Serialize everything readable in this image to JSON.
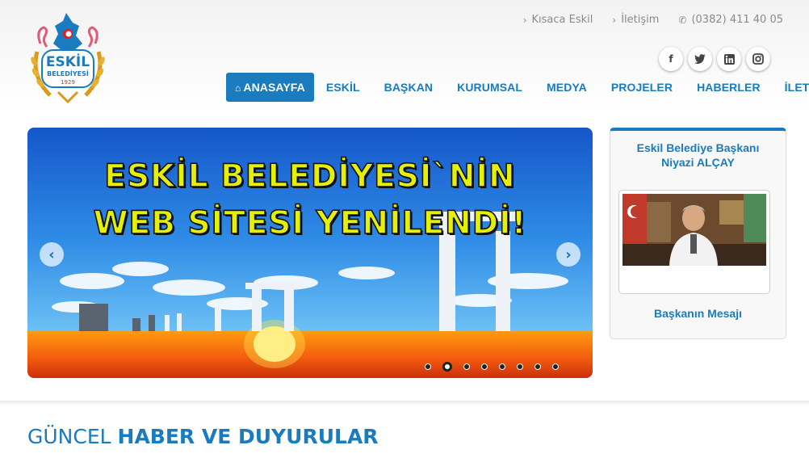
{
  "logo": {
    "name_line1": "ESKİL",
    "name_line2": "BELEDİYESİ",
    "year": "1929"
  },
  "top_links": [
    {
      "label": "Kısaca Eskil",
      "icon": "chevron-right-icon"
    },
    {
      "label": "İletişim",
      "icon": "chevron-right-icon"
    },
    {
      "label": "(0382) 411 40 05",
      "icon": "phone-icon"
    }
  ],
  "social": [
    {
      "name": "facebook-icon",
      "glyph": "f"
    },
    {
      "name": "twitter-icon",
      "glyph": "t"
    },
    {
      "name": "linkedin-icon",
      "glyph": "in"
    },
    {
      "name": "instagram-icon",
      "glyph": "◎"
    }
  ],
  "nav": {
    "home_icon": "home-icon",
    "items": [
      "ANASAYFA",
      "ESKİL",
      "BAŞKAN",
      "KURUMSAL",
      "MEDYA",
      "PROJELER",
      "HABERLER",
      "İLETİŞİM"
    ],
    "active_index": 0
  },
  "slider": {
    "headline_line1": "ESKİL BELEDİYESİ`NİN",
    "headline_line2": "WEB SİTESİ YENİLENDİ!",
    "slide_count": 8,
    "active_slide": 1
  },
  "mayor_box": {
    "title_line1": "Eskil Belediye Başkanı",
    "title_line2": "Niyazi ALÇAY",
    "message_link": "Başkanın Mesajı"
  },
  "news_section": {
    "title_light": "GÜNCEL",
    "title_bold": "HABER VE DUYURULAR"
  },
  "colors": {
    "accent": "#1a7bbf",
    "headline_yellow": "#e5f00a"
  }
}
